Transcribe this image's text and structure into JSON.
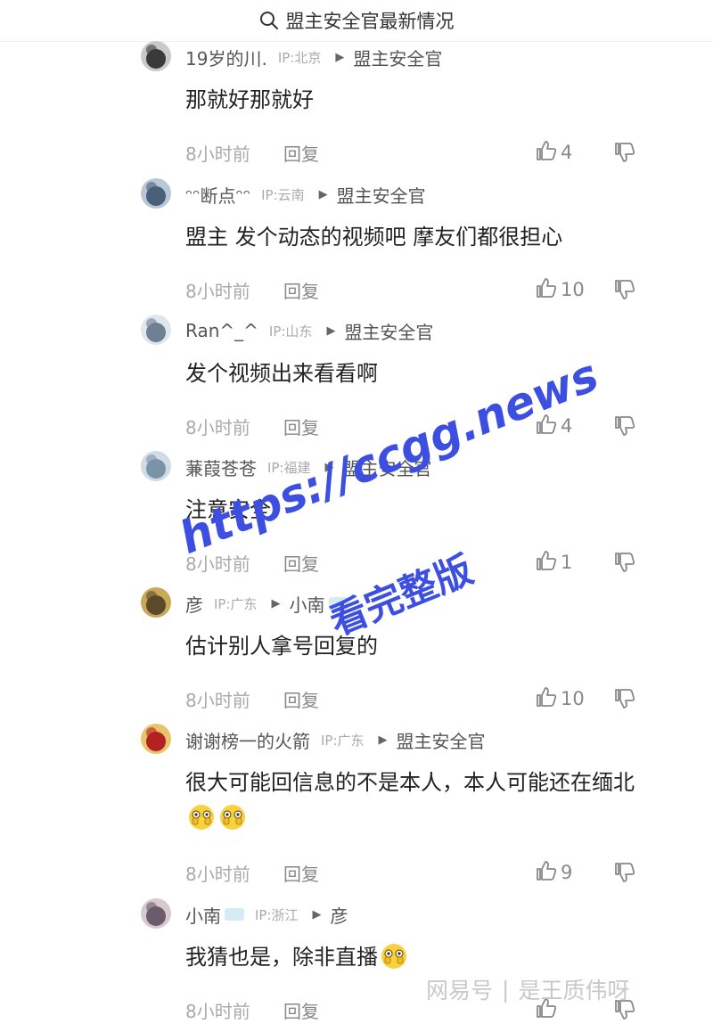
{
  "search": {
    "icon": "search-icon",
    "title": "盟主安全官最新情况"
  },
  "comments": [
    {
      "avatar_colors": [
        "#3a3a3a",
        "#c9c9c9"
      ],
      "user": "19岁的川.",
      "ip": "IP:北京",
      "reply_to": "盟主安全官",
      "reply_badge": false,
      "text": "那就好那就好",
      "emoji_count": 0,
      "time": "8小时前",
      "reply_label": "回复",
      "likes": "4"
    },
    {
      "avatar_colors": [
        "#4a5f7a",
        "#b8c7d8"
      ],
      "user": "ᵔᵔ断点ᵔᵔ",
      "ip": "IP:云南",
      "reply_to": "盟主安全官",
      "reply_badge": false,
      "text": "盟主 发个动态的视频吧 摩友们都很担心",
      "emoji_count": 0,
      "time": "8小时前",
      "reply_label": "回复",
      "likes": "10"
    },
    {
      "avatar_colors": [
        "#6f7f94",
        "#dfe6ee"
      ],
      "user": "Ran^_^",
      "ip": "IP:山东",
      "reply_to": "盟主安全官",
      "reply_badge": false,
      "text": "发个视频出来看看啊",
      "emoji_count": 0,
      "time": "8小时前",
      "reply_label": "回复",
      "likes": "4"
    },
    {
      "avatar_colors": [
        "#7a93a6",
        "#cfdbe5"
      ],
      "user": "蒹葭苍苍",
      "ip": "IP:福建",
      "reply_to": "盟主安全官",
      "reply_badge": false,
      "text": "注意安全",
      "emoji_count": 0,
      "time": "8小时前",
      "reply_label": "回复",
      "likes": "1"
    },
    {
      "avatar_colors": [
        "#5a4a2a",
        "#c9a85a"
      ],
      "user": "彦",
      "ip": "IP:广东",
      "reply_to": "小南",
      "reply_badge": true,
      "text": "估计别人拿号回复的",
      "emoji_count": 0,
      "time": "8小时前",
      "reply_label": "回复",
      "likes": "10"
    },
    {
      "avatar_colors": [
        "#b22222",
        "#e9c46a"
      ],
      "user": "谢谢榜一的火箭",
      "ip": "IP:广东",
      "reply_to": "盟主安全官",
      "reply_badge": false,
      "text": "很大可能回信息的不是本人，本人可能还在缅北",
      "emoji_count": 2,
      "time": "8小时前",
      "reply_label": "回复",
      "likes": "9"
    },
    {
      "avatar_colors": [
        "#6b5b6b",
        "#d8c8d0"
      ],
      "user": "小南",
      "ip": "IP:浙江",
      "reply_to": "彦",
      "reply_badge": false,
      "user_badge": true,
      "text": "我猜也是，除非直播",
      "emoji_count": 1,
      "time": "8小时前",
      "reply_label": "回复",
      "likes": ""
    }
  ],
  "watermark": {
    "url": "https://ccgg.news",
    "sub": "看完整版"
  },
  "source": {
    "left": "网易号",
    "sep": "|",
    "right": "是王质伟呀"
  },
  "icons": {
    "like": "thumbs-up-icon",
    "dislike": "thumbs-down-icon",
    "reply_arrow": "triangle-right-icon",
    "emoji": "peek-emoji-icon"
  }
}
